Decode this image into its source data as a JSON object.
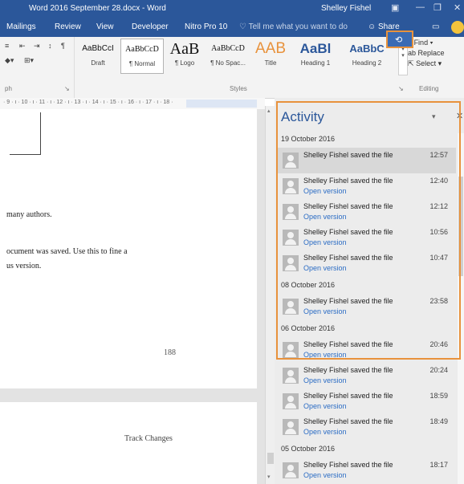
{
  "window": {
    "title": "Word 2016 September 28.docx  -  Word",
    "user": "Shelley Fishel",
    "controls": [
      "▣",
      "—",
      "❐",
      "✕"
    ]
  },
  "menu": {
    "tabs": [
      "Mailings",
      "Review",
      "View",
      "Developer",
      "Nitro Pro 10"
    ],
    "tell_me": "Tell me what you want to do",
    "share": "Share",
    "activity_button_icon": "history-icon",
    "comments_icon": "comment-icon",
    "smiley_icon": "smiley-icon"
  },
  "ribbon": {
    "paragraph_group_label": "ph",
    "styles_group_label": "Styles",
    "editing_group_label": "Editing",
    "styles": [
      {
        "preview": "AaBbCcI",
        "name": "Draft"
      },
      {
        "preview": "AaBbCcD",
        "name": "¶ Normal"
      },
      {
        "preview": "AaB",
        "name": "¶ Logo"
      },
      {
        "preview": "AaBbCcD",
        "name": "¶ No Spac..."
      },
      {
        "preview": "AAB",
        "name": "Title"
      },
      {
        "preview": "AaBl",
        "name": "Heading 1"
      },
      {
        "preview": "AaBbC",
        "name": "Heading 2"
      }
    ],
    "editing": {
      "find": "Find",
      "replace": "Replace",
      "select": "Select"
    }
  },
  "ruler": {
    "marks": "· 9 · ı · 10 · ı · 11 · ı · 12 · ı · 13 · ı · 14 · ı · 15 · ı · 16 · ı · 17 · ı · 18 ·"
  },
  "document": {
    "lines": [
      "many authors.",
      "ocument was saved. Use this to fine a",
      "us version."
    ],
    "page_number": "188",
    "heading": "Track Changes"
  },
  "activity": {
    "title": "Activity",
    "groups": [
      {
        "date": "19 October 2016",
        "entries": [
          {
            "who": "Shelley Fishel saved the file",
            "time": "12:57",
            "link": ""
          },
          {
            "who": "Shelley Fishel saved the file",
            "time": "12:40",
            "link": "Open version"
          },
          {
            "who": "Shelley Fishel saved the file",
            "time": "12:12",
            "link": "Open version"
          },
          {
            "who": "Shelley Fishel saved the file",
            "time": "10:56",
            "link": "Open version"
          },
          {
            "who": "Shelley Fishel saved the file",
            "time": "10:47",
            "link": "Open version"
          }
        ]
      },
      {
        "date": "08 October 2016",
        "entries": [
          {
            "who": "Shelley Fishel saved the file",
            "time": "23:58",
            "link": "Open version"
          }
        ]
      },
      {
        "date": "06 October 2016",
        "entries": [
          {
            "who": "Shelley Fishel saved the file",
            "time": "20:46",
            "link": "Open version"
          },
          {
            "who": "Shelley Fishel saved the file",
            "time": "20:24",
            "link": "Open version"
          },
          {
            "who": "Shelley Fishel saved the file",
            "time": "18:59",
            "link": "Open version"
          },
          {
            "who": "Shelley Fishel saved the file",
            "time": "18:49",
            "link": "Open version"
          }
        ]
      },
      {
        "date": "05 October 2016",
        "entries": [
          {
            "who": "Shelley Fishel saved the file",
            "time": "18:17",
            "link": "Open version"
          }
        ]
      }
    ]
  }
}
